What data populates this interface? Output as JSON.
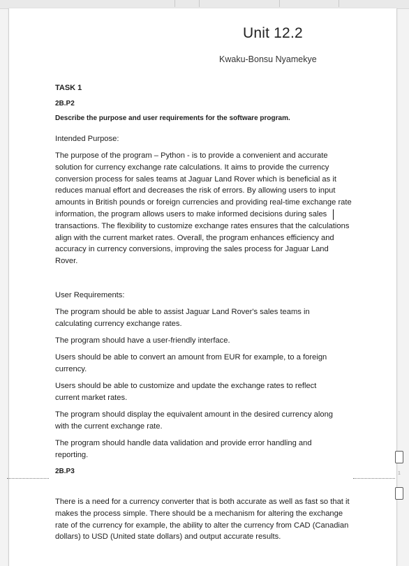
{
  "document": {
    "title": "Unit 12.2",
    "author": "Kwaku-Bonsu Nyamekye",
    "task_label": "TASK 1",
    "criteria_p2": "2B.P2",
    "task_description": "Describe the purpose and user requirements for the software program.",
    "intended_purpose_heading": "Intended Purpose:",
    "intended_purpose_body": "The purpose of the program – Python - is to provide a convenient and accurate solution for currency exchange rate calculations. It aims to provide the currency conversion process for sales teams at Jaguar Land Rover which is beneficial as it reduces manual effort and decreases the risk of errors. By allowing users to input amounts in British pounds or foreign currencies and providing real-time exchange rate information, the program allows users to make informed decisions during sales transactions. The flexibility to customize exchange rates ensures that the calculations align with the current market rates. Overall, the program enhances efficiency and accuracy in currency conversions, improving the sales process for Jaguar Land Rover.",
    "user_requirements_heading": "User Requirements:",
    "requirements": [
      "The program should be able to assist Jaguar Land Rover's sales teams in calculating currency exchange rates.",
      "The program should have a user-friendly interface.",
      "Users should be able to convert an amount from EUR for example, to a foreign currency.",
      "Users should be able to customize and update the exchange rates to reflect current market rates.",
      "The program should display the equivalent amount in the desired currency along with the current exchange rate.",
      "The program should handle data validation and provide error handling and reporting."
    ],
    "criteria_p3": "2B.P3",
    "p3_body": "There is a need for a currency converter that is both accurate as well as fast so that it makes the process simple. There should be a mechanism for altering the exchange rate of the currency for example, the ability to alter the currency from CAD (Canadian dollars) to USD (United state dollars) and output accurate results."
  },
  "gutter": {
    "page_number": "1"
  }
}
